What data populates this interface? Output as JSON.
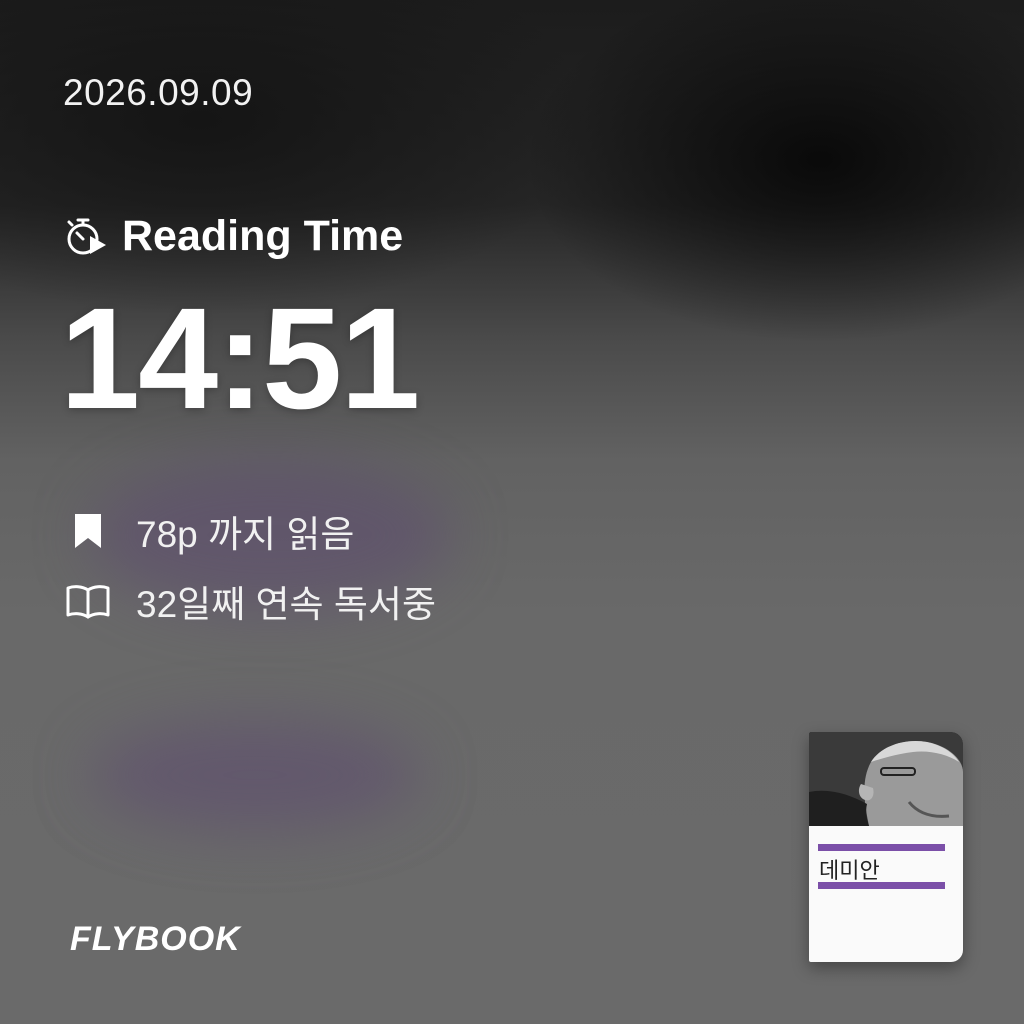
{
  "date": "2026.09.09",
  "reading": {
    "label": "Reading Time",
    "time": "14:51",
    "icon": "stopwatch-play-icon"
  },
  "stats": [
    {
      "icon": "bookmark-icon",
      "text": "78p 까지 읽음"
    },
    {
      "icon": "open-book-icon",
      "text": "32일째 연속 독서중"
    }
  ],
  "logo": "FLYBOOK",
  "book": {
    "title": "데미안",
    "accent_color": "#7b4fa8"
  },
  "colors": {
    "text": "#ffffff",
    "background": "#6b6b6b"
  }
}
